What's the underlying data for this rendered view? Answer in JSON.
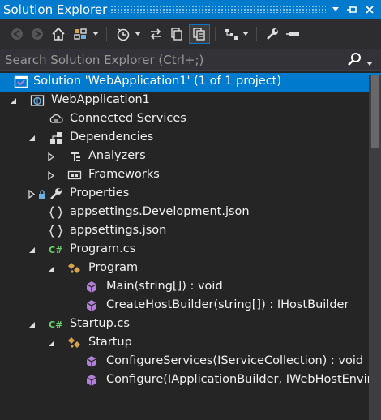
{
  "window": {
    "title": "Solution Explorer"
  },
  "search": {
    "placeholder": "Search Solution Explorer (Ctrl+;)"
  },
  "tree": {
    "solution": "Solution 'WebApplication1' (1 of 1 project)",
    "project": "WebApplication1",
    "connected_services": "Connected Services",
    "dependencies": "Dependencies",
    "analyzers": "Analyzers",
    "frameworks": "Frameworks",
    "properties": "Properties",
    "appsettings_dev": "appsettings.Development.json",
    "appsettings": "appsettings.json",
    "program_cs": "Program.cs",
    "program_class": "Program",
    "main_method": "Main(string[]) : void",
    "create_host_builder": "CreateHostBuilder(string[]) : IHostBuilder",
    "startup_cs": "Startup.cs",
    "startup_class": "Startup",
    "configure_services": "ConfigureServices(IServiceCollection) : void",
    "configure": "Configure(IApplicationBuilder, IWebHostEnviro"
  },
  "colors": {
    "accent": "#007acc",
    "background": "#252526",
    "csharp_green": "#6bd16b",
    "class_orange": "#d7a34a",
    "method_purple": "#b180d7"
  }
}
